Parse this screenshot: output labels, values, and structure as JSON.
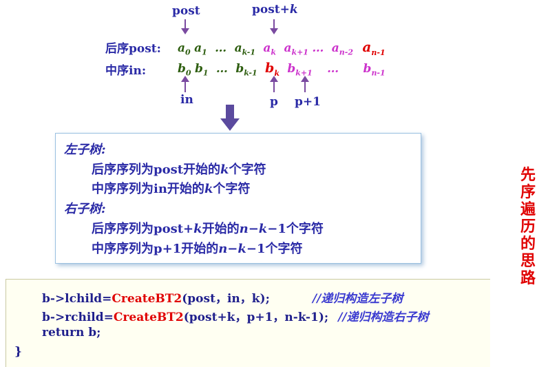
{
  "top_labels": {
    "post": "post",
    "post_k": "post+",
    "post_k_var": "k"
  },
  "bottom_labels": {
    "in": "in",
    "p": "p",
    "p1": "p+1"
  },
  "rows": {
    "post_label": "后序post:",
    "in_label": "中序in:",
    "post_seq": {
      "a0": "a",
      "a0_sub": "0",
      "a1": "a",
      "a1_sub": "1",
      "dots1": "…",
      "ak1": "a",
      "ak1_sub": "k-1",
      "ak": "a",
      "ak_sub": "k",
      "akp1": "a",
      "akp1_sub": "k+1",
      "dots2": "…",
      "an2": "a",
      "an2_sub": "n-2",
      "an1": "a",
      "an1_sub": "n-1"
    },
    "in_seq": {
      "b0": "b",
      "b0_sub": "0",
      "b1": "b",
      "b1_sub": "1",
      "dots1": "…",
      "bk1": "b",
      "bk1_sub": "k-1",
      "bk": "b",
      "bk_sub": "k",
      "bkp1": "b",
      "bkp1_sub": "k+1",
      "dots2": "…",
      "bn1": "b",
      "bn1_sub": "n-1"
    }
  },
  "panel": {
    "left_title": "左子树:",
    "left_post_pre": "后序序列为post开始的",
    "left_post_var": "k",
    "left_post_post": "个字符",
    "left_in_pre": "中序序列为in开始的",
    "left_in_var": "k",
    "left_in_post": "个字符",
    "right_title": "右子树:",
    "right_post_pre": "后序序列为post+",
    "right_post_var": "k",
    "right_post_mid": "开始的",
    "right_post_expr": "n−k−",
    "right_post_num": "1",
    "right_post_post": "个字符",
    "right_in_pre": "中序序列为p+1开始的",
    "right_in_expr": "n−k−",
    "right_in_num": "1",
    "right_in_post": "个字符"
  },
  "code": {
    "l1_a": "b->lchild=",
    "l1_fn": "CreateBT2",
    "l1_b": "(post，in，k);",
    "l1_cmt": "//递归构造左子树",
    "l2_a": "b->rchild=",
    "l2_fn": "CreateBT2",
    "l2_b": "(post+k，p+1，n-k-1);",
    "l2_cmt": "//递归构造右子树",
    "l3": "return b;",
    "l4": "}"
  },
  "side_title": [
    "先",
    "序",
    "遍",
    "历",
    "的",
    "思",
    "路"
  ],
  "colors": {
    "blue": "#2a2aa6",
    "red": "#e00000",
    "magenta": "#cc33cc",
    "green": "#2e5e10"
  }
}
